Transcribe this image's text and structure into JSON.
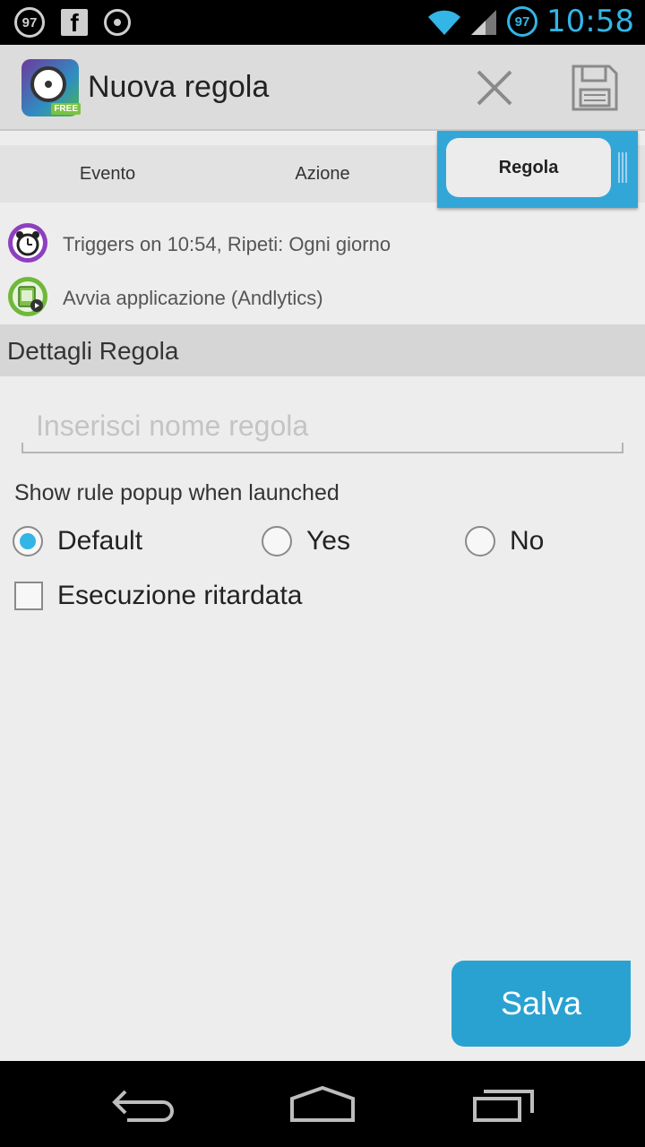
{
  "status_bar": {
    "left_badge": "97",
    "right_badge": "97",
    "time": "10:58",
    "icons": [
      "badge-97-icon",
      "facebook-icon",
      "target-icon",
      "wifi-icon",
      "signal-icon"
    ]
  },
  "action_bar": {
    "title": "Nuova regola",
    "app_icon_badge": "FREE",
    "icons": [
      "close-icon",
      "save-icon"
    ]
  },
  "tabs": [
    {
      "label": "Evento",
      "selected": false
    },
    {
      "label": "Azione",
      "selected": false
    },
    {
      "label": "Regola",
      "selected": true
    }
  ],
  "summary": {
    "trigger": "Triggers on 10:54, Ripeti: Ogni giorno",
    "action": "Avvia applicazione (Andlytics)"
  },
  "section_title": "Dettagli Regola",
  "name_field": {
    "value": "",
    "placeholder": "Inserisci nome regola"
  },
  "popup": {
    "label": "Show rule popup when launched",
    "options": [
      "Default",
      "Yes",
      "No"
    ],
    "selected": "Default"
  },
  "delayed_execution": {
    "label": "Esecuzione ritardata",
    "checked": false
  },
  "save_button": "Salva",
  "colors": {
    "accent": "#33b5e5",
    "tab_selected": "#33a6d8",
    "save_button": "#29a2d2"
  },
  "nav_icons": [
    "back-icon",
    "home-icon",
    "recents-icon"
  ]
}
